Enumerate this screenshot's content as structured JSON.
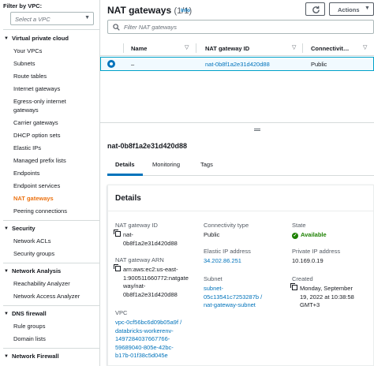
{
  "sidebar": {
    "filter_label": "Filter by VPC:",
    "vpc_placeholder": "Select a VPC",
    "sections": [
      {
        "title": "Virtual private cloud",
        "items": [
          "Your VPCs",
          "Subnets",
          "Route tables",
          "Internet gateways",
          "Egress-only internet gateways",
          "Carrier gateways",
          "DHCP option sets",
          "Elastic IPs",
          "Managed prefix lists",
          "Endpoints",
          "Endpoint services",
          "NAT gateways",
          "Peering connections"
        ]
      },
      {
        "title": "Security",
        "items": [
          "Network ACLs",
          "Security groups"
        ]
      },
      {
        "title": "Network Analysis",
        "items": [
          "Reachability Analyzer",
          "Network Access Analyzer"
        ]
      },
      {
        "title": "DNS firewall",
        "items": [
          "Rule groups",
          "Domain lists"
        ]
      },
      {
        "title": "Network Firewall",
        "items": []
      }
    ],
    "active_item": "NAT gateways"
  },
  "header": {
    "title": "NAT gateways",
    "count": "(1/1)",
    "info": "Info",
    "actions_label": "Actions"
  },
  "search": {
    "placeholder": "Filter NAT gateways"
  },
  "table": {
    "columns": [
      "Name",
      "NAT gateway ID",
      "Connectivit…"
    ],
    "rows": [
      {
        "name": "–",
        "id": "nat-0b8f1a2e31d420d88",
        "connectivity": "Public"
      }
    ]
  },
  "details": {
    "id": "nat-0b8f1a2e31d420d88",
    "tabs": [
      "Details",
      "Monitoring",
      "Tags"
    ],
    "card_title": "Details",
    "fields": {
      "nat_id_label": "NAT gateway ID",
      "nat_id_value": "nat-\n0b8f1a2e31d420d88",
      "arn_label": "NAT gateway ARN",
      "arn_value": "arn:aws:ec2:us-east-\n1:900511660772:natgate\nway/nat-\n0b8f1a2e31d420d88",
      "vpc_label": "VPC",
      "vpc_value": "vpc-0cf56bc6d09b05a9f /\ndatabricks-workerenv-\n1497284037667766-\n59689040-805e-42bc-\nb17b-01f38c5d045e",
      "connectivity_label": "Connectivity type",
      "connectivity_value": "Public",
      "eip_label": "Elastic IP address",
      "eip_value": "34.202.86.251",
      "subnet_label": "Subnet",
      "subnet_value": "subnet-\n05c13541c7253287b /\nnat-gateway-subnet",
      "state_label": "State",
      "state_value": "Available",
      "private_ip_label": "Private IP address",
      "private_ip_value": "10.169.0.19",
      "created_label": "Created",
      "created_value": "Monday, September\n19, 2022 at 10:38:58\nGMT+3"
    }
  },
  "colors": {
    "accent": "#ec7211",
    "link": "#0073bb",
    "success": "#1d8102",
    "selected_row": "#f1faff"
  }
}
